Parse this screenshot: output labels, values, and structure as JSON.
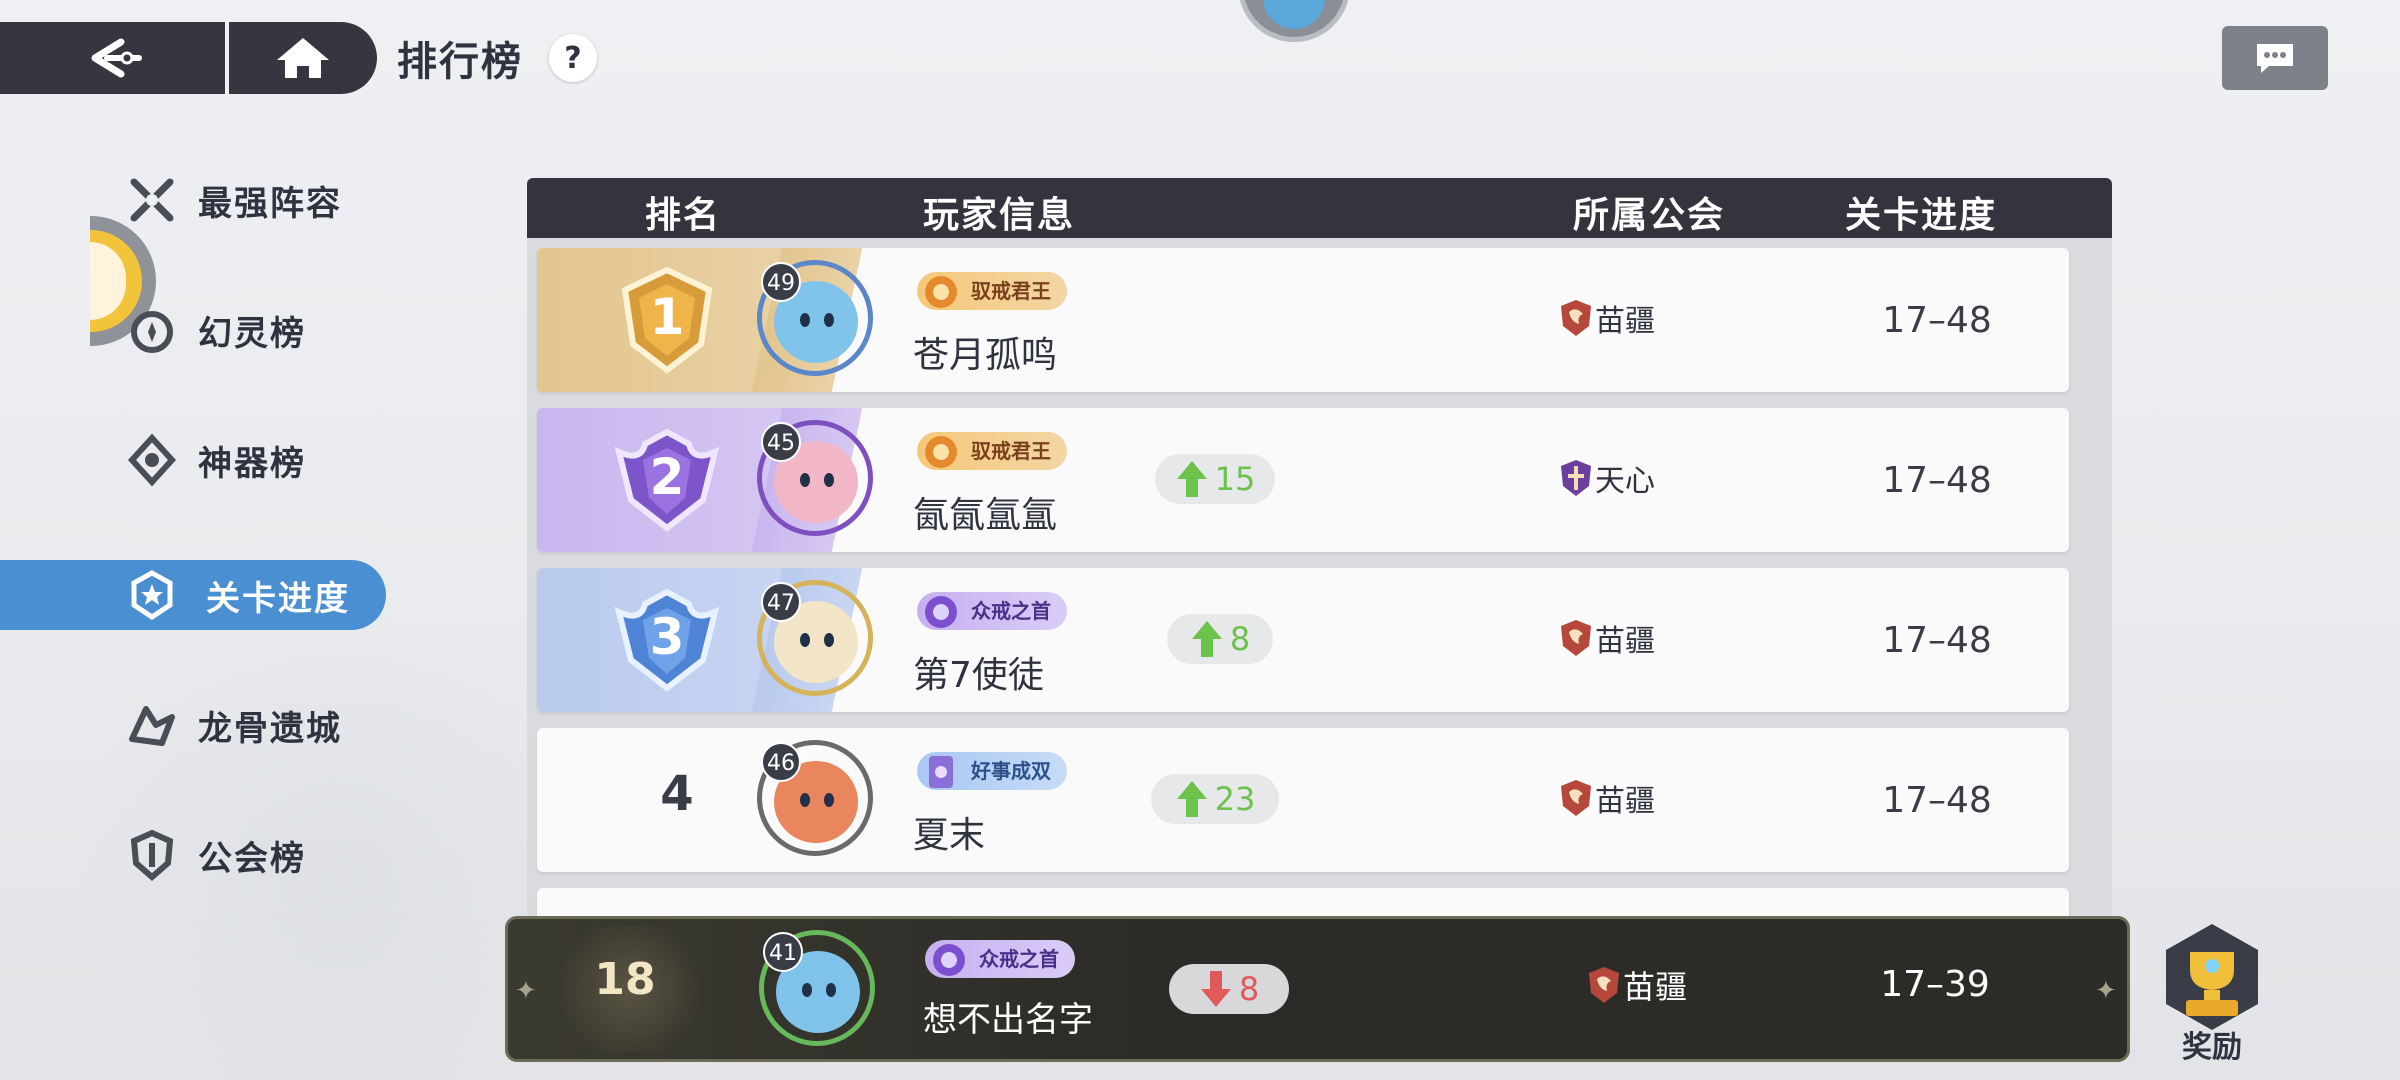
{
  "header": {
    "title": "排行榜",
    "help_label": "?"
  },
  "sidebar": {
    "items": [
      {
        "label": "最强阵容",
        "icon": "crossed-swords-icon",
        "active": false
      },
      {
        "label": "幻灵榜",
        "icon": "spirit-icon",
        "active": false
      },
      {
        "label": "神器榜",
        "icon": "artifact-icon",
        "active": false
      },
      {
        "label": "关卡进度",
        "icon": "star-badge-icon",
        "active": true
      },
      {
        "label": "龙骨遗城",
        "icon": "dragon-icon",
        "active": false
      },
      {
        "label": "公会榜",
        "icon": "guild-shield-icon",
        "active": false
      }
    ]
  },
  "table": {
    "columns": [
      "排名",
      "玩家信息",
      "所属公会",
      "关卡进度"
    ],
    "rows": [
      {
        "rank": "1",
        "level": "49",
        "title": "驭戒君王",
        "title_style": "gold",
        "name": "苍月孤鸣",
        "change": "",
        "guild": "苗疆",
        "progress": "17–48",
        "avatar_color": "#7fc3ea",
        "frame_color": "#5b86c9"
      },
      {
        "rank": "2",
        "level": "45",
        "title": "驭戒君王",
        "title_style": "gold",
        "name": "氤氤氲氲",
        "change": "15",
        "guild": "天心",
        "progress": "17–48",
        "avatar_color": "#f2b7c6",
        "frame_color": "#7d4fbf"
      },
      {
        "rank": "3",
        "level": "47",
        "title": "众戒之首",
        "title_style": "purple",
        "name": "第7使徒",
        "change": "8",
        "guild": "苗疆",
        "progress": "17–48",
        "avatar_color": "#f3e6c8",
        "frame_color": "#d6b35a"
      },
      {
        "rank": "4",
        "level": "46",
        "title": "好事成双",
        "title_style": "blue",
        "name": "夏末",
        "change": "23",
        "guild": "苗疆",
        "progress": "17–48",
        "avatar_color": "#e9865e",
        "frame_color": "#6a6a6a"
      }
    ]
  },
  "my_entry": {
    "rank": "18",
    "level": "41",
    "title": "众戒之首",
    "name": "想不出名字",
    "change": "8",
    "guild": "苗疆",
    "progress": "17–39"
  },
  "reward": {
    "label": "奖励"
  },
  "colors": {
    "accent": "#4a8fd2",
    "rise": "#6cc24a",
    "fall": "#e05a5a",
    "dark": "#33343d"
  }
}
